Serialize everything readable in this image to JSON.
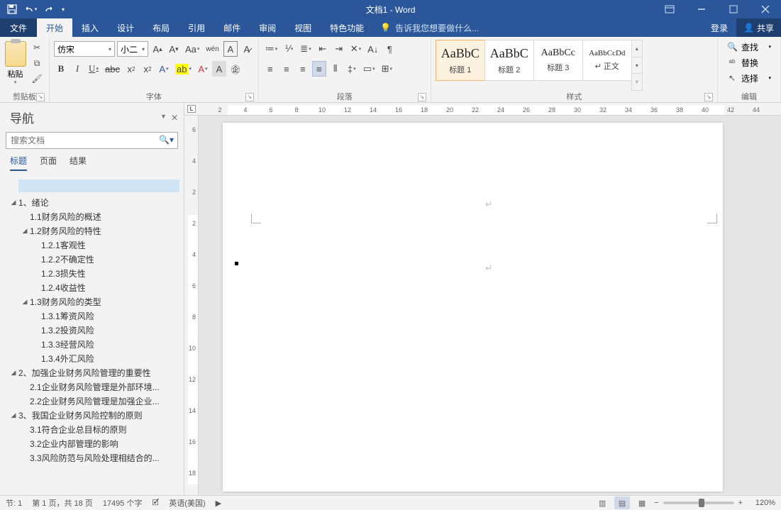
{
  "title": "文档1 - Word",
  "qat": {
    "save": "💾",
    "undo": "↶",
    "redo": "↷"
  },
  "tabs": {
    "file": "文件",
    "items": [
      "开始",
      "插入",
      "设计",
      "布局",
      "引用",
      "邮件",
      "审阅",
      "视图",
      "特色功能"
    ],
    "active_index": 0,
    "tell_me": "告诉我您想要做什么...",
    "login": "登录",
    "share": "共享"
  },
  "ribbon": {
    "clipboard": {
      "paste": "粘贴",
      "label": "剪贴板"
    },
    "font": {
      "name": "仿宋",
      "size": "小二",
      "label": "字体"
    },
    "paragraph": {
      "label": "段落"
    },
    "styles": {
      "label": "样式",
      "items": [
        {
          "preview": "AaBbC",
          "name": "标题 1"
        },
        {
          "preview": "AaBbC",
          "name": "标题 2"
        },
        {
          "preview": "AaBbCc",
          "name": "标题 3"
        },
        {
          "preview": "AaBbCcDd",
          "name": "↵ 正文"
        }
      ]
    },
    "editing": {
      "find": "查找",
      "replace": "替换",
      "select": "选择",
      "label": "编辑"
    }
  },
  "nav": {
    "title": "导航",
    "search_placeholder": "搜索文档",
    "tabs": [
      "标题",
      "页面",
      "结果"
    ],
    "active_tab": 0,
    "tree": [
      {
        "lvl": 0,
        "tw": "◢",
        "text": "1、绪论"
      },
      {
        "lvl": 1,
        "tw": "",
        "text": "1.1财务风险的概述"
      },
      {
        "lvl": 1,
        "tw": "◢",
        "text": "1.2财务风险的特性"
      },
      {
        "lvl": 2,
        "tw": "",
        "text": "1.2.1客观性"
      },
      {
        "lvl": 2,
        "tw": "",
        "text": "1.2.2不确定性"
      },
      {
        "lvl": 2,
        "tw": "",
        "text": "1.2.3损失性"
      },
      {
        "lvl": 2,
        "tw": "",
        "text": "1.2.4收益性"
      },
      {
        "lvl": 1,
        "tw": "◢",
        "text": "1.3财务风险的类型"
      },
      {
        "lvl": 2,
        "tw": "",
        "text": "1.3.1筹资风险"
      },
      {
        "lvl": 2,
        "tw": "",
        "text": "1.3.2投资风险"
      },
      {
        "lvl": 2,
        "tw": "",
        "text": "1.3.3经营风险"
      },
      {
        "lvl": 2,
        "tw": "",
        "text": "1.3.4外汇风险"
      },
      {
        "lvl": 0,
        "tw": "◢",
        "text": "2、加强企业财务风险管理的重要性"
      },
      {
        "lvl": 1,
        "tw": "",
        "text": "2.1企业财务风险管理是外部环境..."
      },
      {
        "lvl": 1,
        "tw": "",
        "text": "2.2企业财务风险管理是加强企业..."
      },
      {
        "lvl": 0,
        "tw": "◢",
        "text": "3、我国企业财务风险控制的原则"
      },
      {
        "lvl": 1,
        "tw": "",
        "text": "3.1符合企业总目标的原则"
      },
      {
        "lvl": 1,
        "tw": "",
        "text": "3.2企业内部管理的影响"
      },
      {
        "lvl": 1,
        "tw": "",
        "text": "3.3风险防范与风险处理相结合的..."
      }
    ]
  },
  "ruler_h": [
    2,
    4,
    6,
    8,
    10,
    12,
    14,
    16,
    18,
    20,
    22,
    24,
    26,
    28,
    30,
    32,
    34,
    36,
    38,
    40,
    42,
    44
  ],
  "ruler_v": [
    6,
    4,
    2,
    2,
    4,
    6,
    8,
    10,
    12,
    14,
    16,
    18
  ],
  "status": {
    "section": "节: 1",
    "page": "第 1 页，共 18 页",
    "words": "17495 个字",
    "lang": "英语(美国)",
    "zoom": "120%"
  }
}
